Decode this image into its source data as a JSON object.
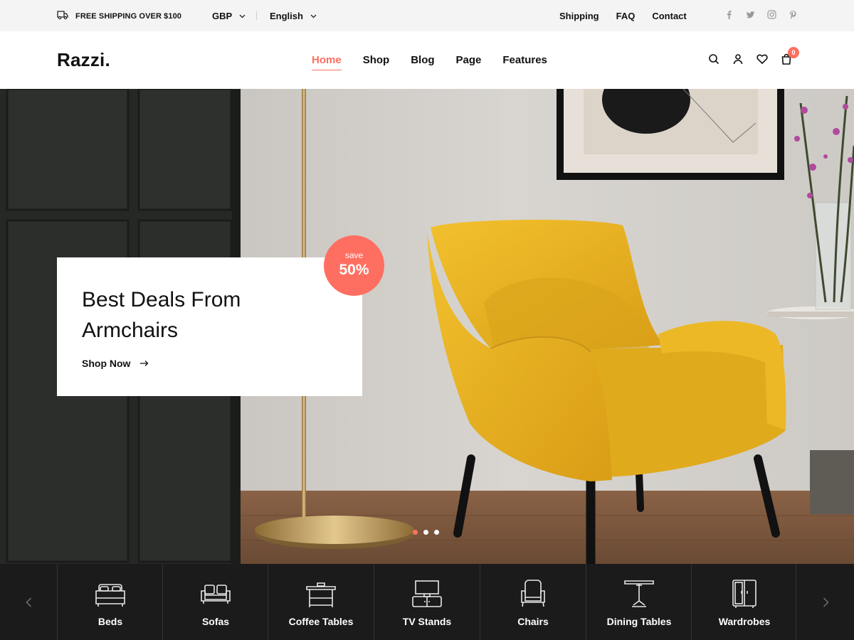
{
  "topbar": {
    "shipping_text": "FREE SHIPPING OVER $100",
    "currency": "GBP",
    "language": "English",
    "links": [
      "Shipping",
      "FAQ",
      "Contact"
    ],
    "social_icons": [
      "facebook-icon",
      "twitter-icon",
      "instagram-icon",
      "pinterest-icon"
    ]
  },
  "header": {
    "logo": "Razzi.",
    "nav": [
      {
        "label": "Home",
        "active": true
      },
      {
        "label": "Shop",
        "active": false
      },
      {
        "label": "Blog",
        "active": false
      },
      {
        "label": "Page",
        "active": false
      },
      {
        "label": "Features",
        "active": false
      }
    ],
    "icons": [
      "search-icon",
      "user-icon",
      "heart-icon",
      "cart-icon"
    ],
    "cart_count": "0"
  },
  "hero": {
    "title": "Best Deals From Armchairs",
    "cta": "Shop Now",
    "badge_top": "save",
    "badge_value": "50%",
    "slides": 3,
    "active_slide": 1
  },
  "categories": [
    {
      "label": "Beds",
      "icon": "bed-icon"
    },
    {
      "label": "Sofas",
      "icon": "sofa-icon"
    },
    {
      "label": "Coffee Tables",
      "icon": "coffee-table-icon"
    },
    {
      "label": "TV Stands",
      "icon": "tv-stand-icon"
    },
    {
      "label": "Chairs",
      "icon": "armchair-icon"
    },
    {
      "label": "Dining Tables",
      "icon": "dining-table-icon"
    },
    {
      "label": "Wardrobes",
      "icon": "wardrobe-icon"
    }
  ],
  "colors": {
    "accent": "#ff6f61",
    "topbar_bg": "#f4f4f4",
    "category_bar_bg": "#1b1b1b",
    "chair": "#e8b422"
  }
}
